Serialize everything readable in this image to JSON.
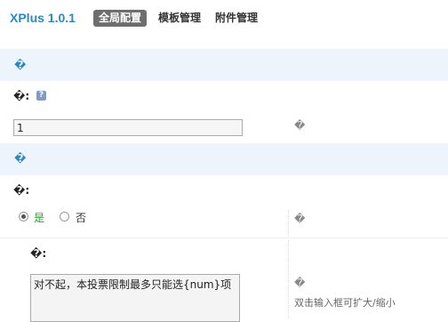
{
  "header": {
    "brand": "XPlus 1.0.1",
    "tabs": [
      {
        "label": "全局配置",
        "active": true
      },
      {
        "label": "模板管理",
        "active": false
      },
      {
        "label": "附件管理",
        "active": false
      }
    ]
  },
  "sections": [
    {
      "title": "�"
    },
    {
      "title": "�"
    }
  ],
  "field1": {
    "label": "�:",
    "help_icon": "question-bubble-icon",
    "value": "1",
    "tip": "�"
  },
  "field2": {
    "label": "�:",
    "options": [
      {
        "label": "是",
        "checked": true
      },
      {
        "label": "否",
        "checked": false
      }
    ],
    "tip": "�"
  },
  "field3": {
    "label": "�:",
    "value": "对不起，本投票限制最多只能选{num}项",
    "tip": "�",
    "hint": "双击输入框可扩大/缩小"
  },
  "colors": {
    "brand": "#2c88c0",
    "band_bg": "#eef4fb",
    "active_tab_bg": "#6e6e6e",
    "yes_green": "#2a9d2a"
  }
}
